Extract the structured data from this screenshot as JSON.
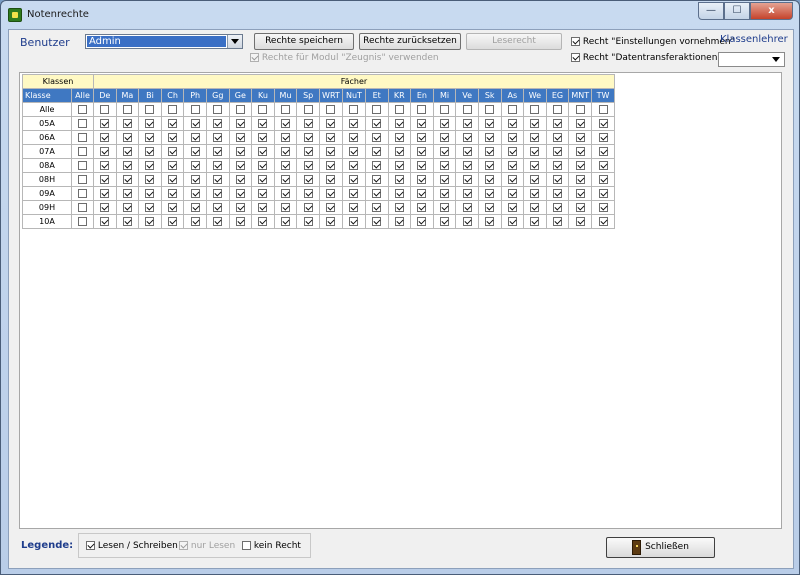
{
  "window": {
    "title": "Notenrechte",
    "min_glyph": "—",
    "max_glyph": "☐",
    "close_glyph": "x"
  },
  "toolbar": {
    "benutzer_label": "Benutzer",
    "benutzer_value": "Admin",
    "save_label": "Rechte speichern",
    "reset_label": "Rechte zurücksetzen",
    "read_label": "Leserecht",
    "zeugnis_label": "Rechte für Modul \"Zeugnis\" verwenden",
    "zeugnis_checked": true,
    "einstellungen_label": "Recht \"Einstellungen vornehmen\"",
    "einstellungen_checked": true,
    "datentransfer_label": "Recht \"Datentransferaktionen\"",
    "datentransfer_checked": true,
    "klassenlehrer_label": "Klassenlehrer",
    "klassenlehrer_value": ""
  },
  "grid": {
    "group_klassen": "Klassen",
    "group_faecher": "Fächer",
    "col_klasse": "Klasse",
    "col_alle": "Alle",
    "subjects": [
      "De",
      "Ma",
      "Bi",
      "Ch",
      "Ph",
      "Gg",
      "Ge",
      "Ku",
      "Mu",
      "Sp",
      "WRT",
      "NuT",
      "Et",
      "KR",
      "En",
      "Mi",
      "Ve",
      "Sk",
      "As",
      "We",
      "EG",
      "MNT",
      "TW"
    ],
    "rows": [
      {
        "klasse": "Alle",
        "alle": false,
        "all_subjects": false
      },
      {
        "klasse": "05A",
        "alle": false,
        "all_subjects": true
      },
      {
        "klasse": "06A",
        "alle": false,
        "all_subjects": true
      },
      {
        "klasse": "07A",
        "alle": false,
        "all_subjects": true
      },
      {
        "klasse": "08A",
        "alle": false,
        "all_subjects": true
      },
      {
        "klasse": "08H",
        "alle": false,
        "all_subjects": true
      },
      {
        "klasse": "09A",
        "alle": false,
        "all_subjects": true
      },
      {
        "klasse": "09H",
        "alle": false,
        "all_subjects": true
      },
      {
        "klasse": "10A",
        "alle": false,
        "all_subjects": true
      }
    ]
  },
  "legend": {
    "label": "Legende:",
    "read_write": "Lesen / Schreiben",
    "read_only": "nur Lesen",
    "no_right": "kein Recht"
  },
  "close_label": "Schließen"
}
